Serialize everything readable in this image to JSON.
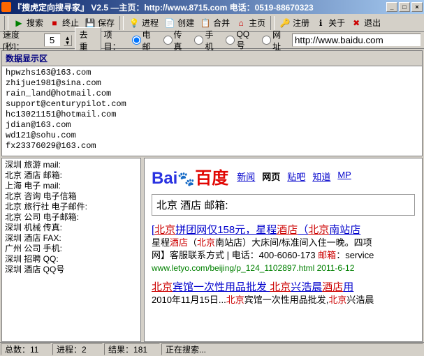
{
  "titlebar": {
    "text": "『捜虎定向搜寻家』 V2.5  —主页：http://www.8715.com 电话：0519-88670323"
  },
  "toolbar": {
    "search": "搜索",
    "stop": "终止",
    "save": "保存",
    "process": "进程",
    "create": "创建",
    "merge": "合并",
    "home": "主页",
    "register": "注册",
    "about": "关于",
    "exit": "退出"
  },
  "optbar": {
    "speed_label": "速度[秒]：",
    "speed_value": "5",
    "dedup": "去重",
    "project_label": "项目：",
    "radio_email": "电邮",
    "radio_fax": "传真",
    "radio_mobile": "手机",
    "radio_qq": "QQ号",
    "radio_url": "网址",
    "url_value": "http://www.baidu.com"
  },
  "data_area": {
    "header": "数据显示区",
    "lines": [
      "hpwzhs163@163.com",
      "zhijue1981@sina.com",
      "rain_land@hotmail.com",
      "support@centurypilot.com",
      "hc13021151@hotmail.com",
      "jdian@163.com",
      "wd121@sohu.com",
      "fx23376029@163.com"
    ]
  },
  "left_list": [
    "深圳 旅游 mail:",
    "北京 酒店 邮箱:",
    "上海 电子 mail:",
    "北京 咨询 电子信箱",
    "北京 旅行社 电子邮件:",
    "北京 公司 电子邮箱:",
    "深圳 机械 传真:",
    "深圳 酒店 FAX:",
    "广州 公司 手机:",
    "深圳 招聘 QQ:",
    "深圳 酒店 QQ号"
  ],
  "baidu": {
    "nav": {
      "news": "新闻",
      "web": "网页",
      "tieba": "贴吧",
      "zhidao": "知道",
      "mp": "MP"
    },
    "search_value": "北京 酒店 邮箱:",
    "results": [
      {
        "title_html": "[<em>北京</em>拼团网仅158元，星程<em>酒店</em>（<em>北京</em>南站店",
        "snippet_html": "星程<em>酒店</em>（<em>北京</em>南站店）大床间/标准间入住一晚。四项<br>网】客服联系方式 | 电话：400-6060-173 <em>邮箱</em>：service",
        "url_text": "www.letyo.com/beijing/p_124_1102897.html 2011-6-12"
      },
      {
        "title_html": "<em>北京</em>宾馆一次性用品批发  <em>北京</em>兴浩晨<em>酒店</em>用",
        "snippet_html": "2010年11月15日...<em>北京</em>宾馆一次性用品批发,<em>北京</em>兴浩晨"
      }
    ]
  },
  "status": {
    "total_label": "总数：",
    "total_val": "11",
    "proc_label": "进程：",
    "proc_val": "2",
    "result_label": "结果：",
    "result_val": "181",
    "msg": "正在搜索..."
  }
}
